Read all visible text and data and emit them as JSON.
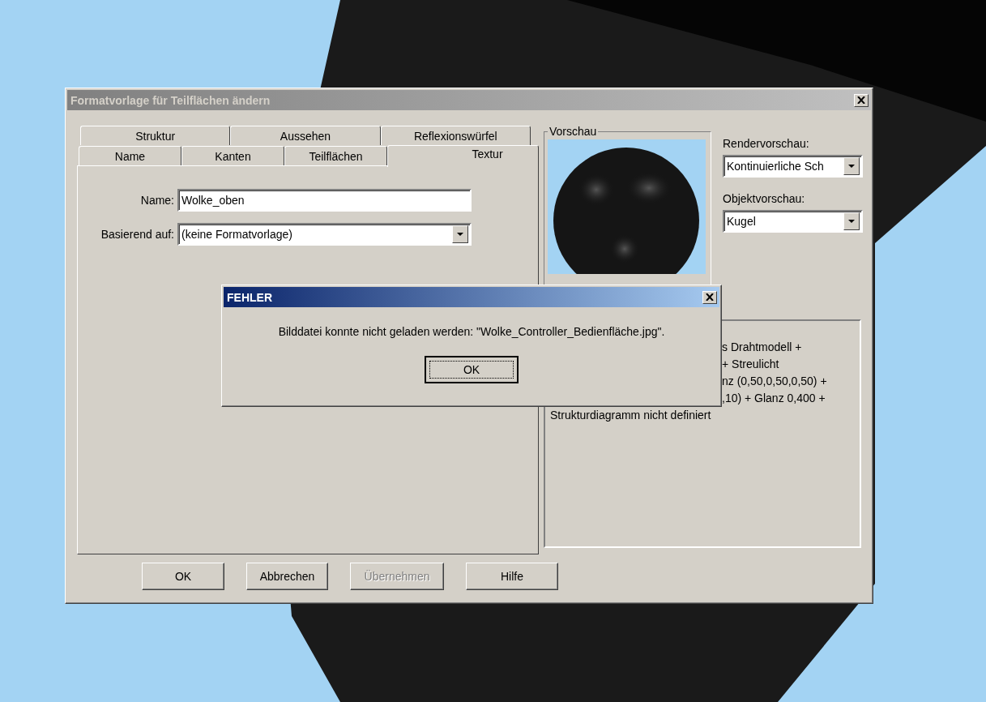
{
  "window": {
    "title": "Formatvorlage für Teilflächen ändern",
    "active": false
  },
  "tabs": {
    "back_row": [
      {
        "label": "Struktur",
        "selected": false
      },
      {
        "label": "Aussehen",
        "selected": false
      },
      {
        "label": "Reflexionswürfel",
        "selected": false
      }
    ],
    "front_row": [
      {
        "label": "Name",
        "selected": false
      },
      {
        "label": "Kanten",
        "selected": false
      },
      {
        "label": "Teilflächen",
        "selected": false
      },
      {
        "label": "Textur",
        "selected": true
      }
    ]
  },
  "form": {
    "name_label": "Name:",
    "name_value": "Wolke_oben",
    "based_on_label": "Basierend auf:",
    "based_on_value": "(keine Formatvorlage)"
  },
  "preview": {
    "title": "Vorschau"
  },
  "render_preview": {
    "label": "Rendervorschau:",
    "value": "Kontinuierliche Sch"
  },
  "object_preview": {
    "label": "Objektvorschau:",
    "value": "Kugel"
  },
  "description_lines": [
    {
      "text": "s Drahtmodell +",
      "partly_covered": true
    },
    {
      "text": "+ Streulicht",
      "partly_covered": true
    },
    {
      "text": "nz (0,50,0,50,0,50) +",
      "partly_covered": true
    },
    {
      "text": ",10) + Glanz 0,400 +",
      "partly_covered": true
    },
    {
      "text": "Strukturdiagramm nicht definiert",
      "partly_covered": false
    }
  ],
  "buttons": [
    {
      "label": "OK",
      "disabled": false
    },
    {
      "label": "Abbrechen",
      "disabled": false
    },
    {
      "label": "Übernehmen",
      "disabled": true
    },
    {
      "label": "Hilfe",
      "disabled": false
    }
  ],
  "error_dialog": {
    "title": "FEHLER",
    "message": "Bilddatei konnte nicht geladen werden: \"Wolke_Controller_Bedienfläche.jpg\".",
    "button": "OK"
  }
}
